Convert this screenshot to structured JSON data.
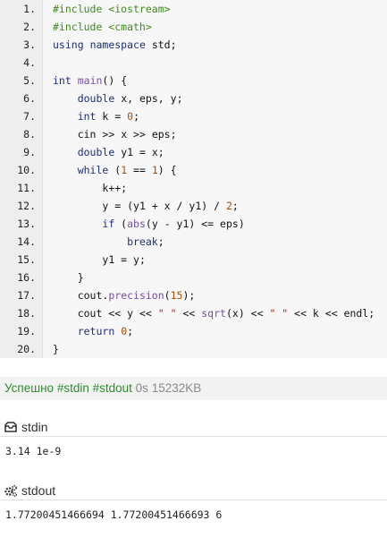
{
  "code": {
    "line_numbers": [
      "1.",
      "2.",
      "3.",
      "4.",
      "5.",
      "6.",
      "7.",
      "8.",
      "9.",
      "10.",
      "11.",
      "12.",
      "13.",
      "14.",
      "15.",
      "16.",
      "17.",
      "18.",
      "19.",
      "20."
    ],
    "lines": [
      "#include <iostream>",
      "#include <cmath>",
      "using namespace std;",
      "",
      "int main() {",
      "    double x, eps, y;",
      "    int k = 0;",
      "    cin >> x >> eps;",
      "    double y1 = x;",
      "    while (1 == 1) {",
      "        k++;",
      "        y = (y1 + x / y1) / 2;",
      "        if (abs(y - y1) <= eps)",
      "            break;",
      "        y1 = y;",
      "    }",
      "    cout.precision(15);",
      "    cout << y << \" \" << sqrt(x) << \" \" << k << endl;",
      "    return 0;",
      "}"
    ]
  },
  "status": {
    "result": "Успешно",
    "tag_stdin": "#stdin",
    "tag_stdout": "#stdout",
    "time": "0s",
    "memory": "15232KB"
  },
  "stdin": {
    "icon": "inbox-icon",
    "title": "stdin",
    "content": "3.14 1e-9"
  },
  "stdout": {
    "icon": "gears-icon",
    "title": "stdout",
    "content": "1.77200451466694 1.77200451466693 6"
  },
  "colors": {
    "success": "#2e8b2e",
    "keyword": "#1a2f7a",
    "preprocessor": "#3f8a1f",
    "string": "#c41a16",
    "number": "#b04d00",
    "code_background": "#f7f7f7",
    "gutter_background": "#eeeeee"
  }
}
